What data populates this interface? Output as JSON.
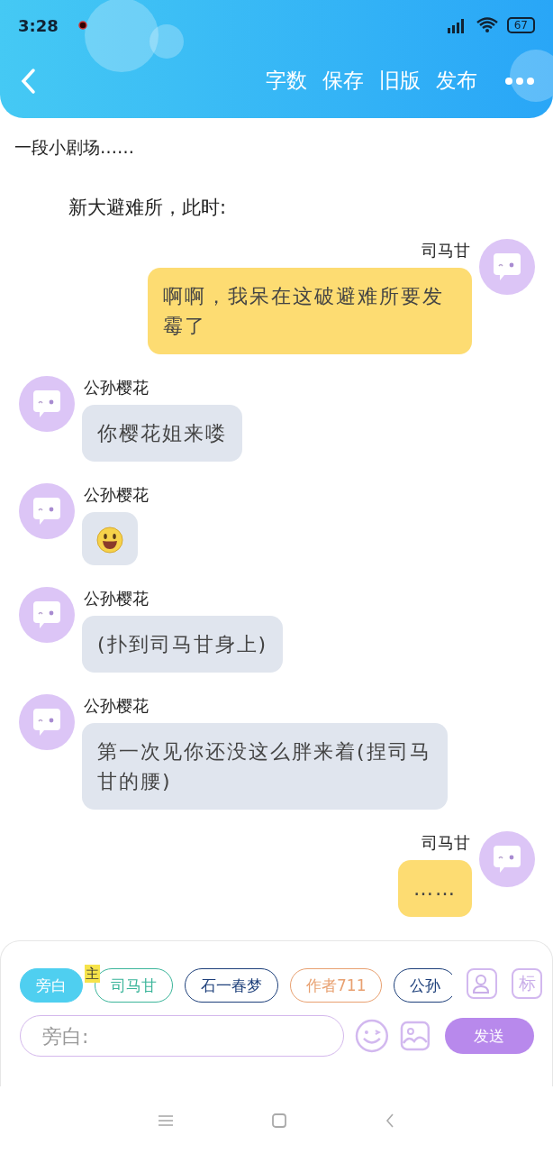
{
  "status_bar": {
    "time": "3:28",
    "battery": "67"
  },
  "header": {
    "actions": [
      "字数",
      "保存",
      "旧版",
      "发布"
    ]
  },
  "intro": "一段小剧场……",
  "scene": "新大避难所，此时:",
  "messages": [
    {
      "outgoing": true,
      "kind": "text",
      "name": "司马甘",
      "text": "啊啊，我呆在这破避难所要发霉了"
    },
    {
      "outgoing": false,
      "kind": "text",
      "name": "公孙樱花",
      "text": "你樱花姐来喽"
    },
    {
      "outgoing": false,
      "kind": "emoji",
      "name": "公孙樱花"
    },
    {
      "outgoing": false,
      "kind": "text",
      "name": "公孙樱花",
      "text": "(扑到司马甘身上)"
    },
    {
      "outgoing": false,
      "kind": "text",
      "name": "公孙樱花",
      "text": "第一次见你还没这么胖来着(捏司马甘的腰)"
    },
    {
      "outgoing": true,
      "kind": "text",
      "name": "司马甘",
      "text": "……"
    }
  ],
  "composer": {
    "roles": [
      {
        "label": "旁白",
        "selected": true,
        "color": "#4fcff0"
      },
      {
        "label": "司马甘",
        "selected": false,
        "color": "#3bb59a",
        "badge": "主"
      },
      {
        "label": "石一春梦",
        "selected": false,
        "color": "#1d3f7a"
      },
      {
        "label": "作者711",
        "selected": false,
        "color": "#e8a070"
      },
      {
        "label": "公孙",
        "selected": false,
        "color": "#1d3f7a"
      }
    ],
    "tag_button": "标",
    "placeholder": "旁白:",
    "send": "发送"
  }
}
